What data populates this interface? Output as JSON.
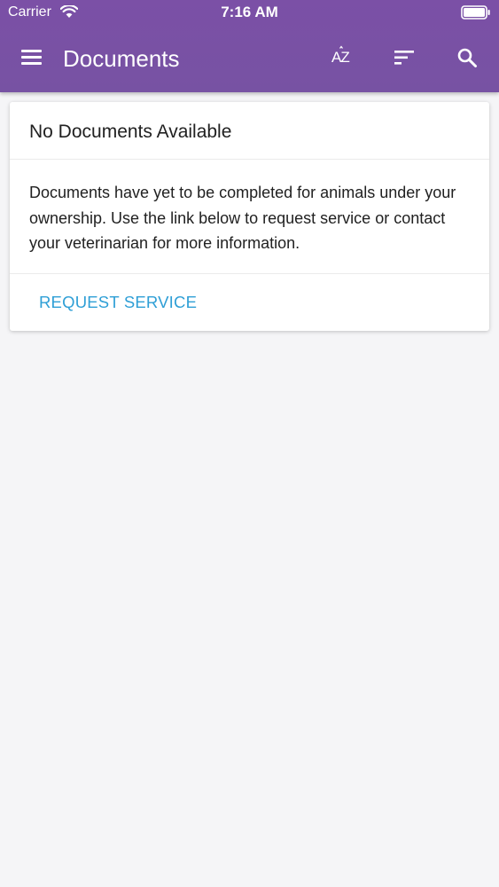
{
  "status_bar": {
    "carrier": "Carrier",
    "time": "7:16 AM"
  },
  "app_bar": {
    "title": "Documents",
    "sort_az_label": "AZ",
    "menu_icon": "hamburger-menu-icon",
    "sort_icon": "sort-lines-icon",
    "search_icon": "search-icon"
  },
  "card": {
    "title": "No Documents Available",
    "body": "Documents have yet to be completed for animals under your ownership. Use the link below to request service or contact your veterinarian for more information.",
    "action_label": "REQUEST SERVICE"
  },
  "colors": {
    "header": "#7b50a6",
    "link": "#2f9fd6",
    "background": "#f5f5f7"
  }
}
